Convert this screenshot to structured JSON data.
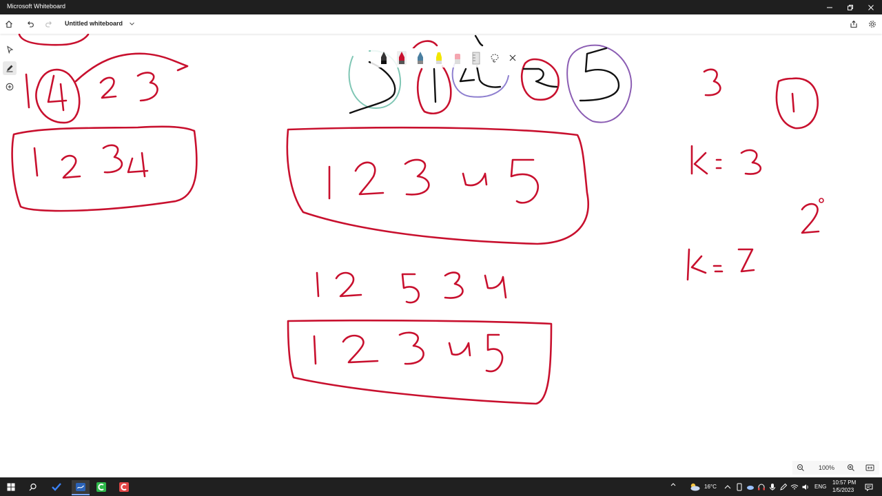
{
  "window": {
    "app_title": "Microsoft Whiteboard"
  },
  "toolbar": {
    "board_title": "Untitled whiteboard"
  },
  "ink_palette": {
    "pens": [
      {
        "name": "black-pen",
        "color": "#111111"
      },
      {
        "name": "red-pen",
        "color": "#c8102e"
      },
      {
        "name": "blue-pen",
        "color": "#4a7fa0"
      },
      {
        "name": "yellow-highlighter",
        "color": "#f2e600"
      },
      {
        "name": "pink-eraser",
        "color": "#f4a6b0"
      },
      {
        "name": "ruler",
        "color": "#cccccc"
      }
    ]
  },
  "colors": {
    "ink_red": "#c8102e",
    "ink_black": "#111111",
    "titlebar_bg": "#1f1f1f",
    "taskbar_bg": "#202020"
  },
  "zoom": {
    "level": "100%"
  },
  "taskbar": {
    "weather": "16°C",
    "language": "ENG",
    "time": "10:57 PM",
    "date": "1/5/2023"
  }
}
